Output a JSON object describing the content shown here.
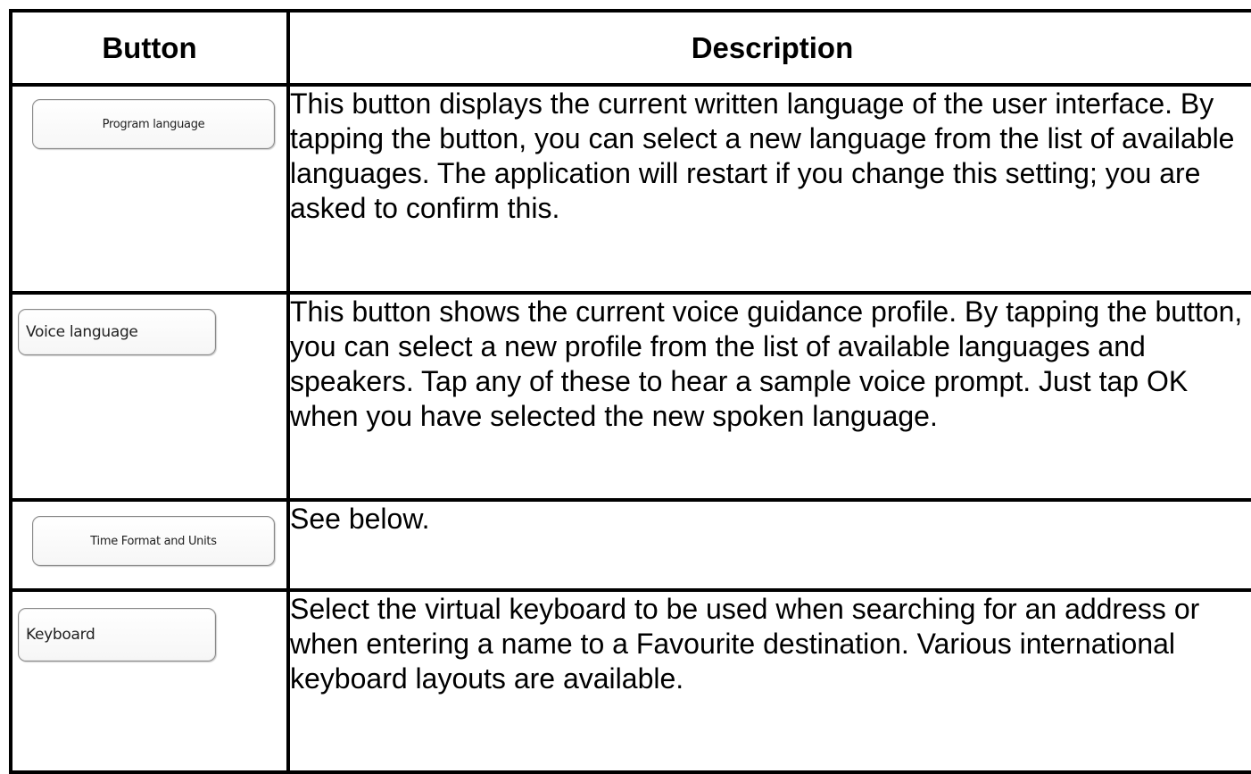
{
  "header": {
    "button_col": "Button",
    "description_col": "Description"
  },
  "rows": [
    {
      "button_label": "Program language",
      "description": "This button displays the current written language of the user interface. By tapping the button, you can select a new language from the list of available languages. The application will restart if you change this setting; you are asked to confirm this."
    },
    {
      "button_label": "Voice language",
      "description": "This button shows the current voice guidance profile. By tapping the button, you can select a new profile from the list of available languages and speakers. Tap any of these to hear a sample voice prompt. Just tap OK when you have selected the new spoken language."
    },
    {
      "button_label": "Time Format and Units",
      "description": "See below."
    },
    {
      "button_label": "Keyboard",
      "description": "Select the virtual keyboard to be used when searching for an address or when entering a name to a Favourite destination. Various international keyboard layouts are available."
    }
  ]
}
